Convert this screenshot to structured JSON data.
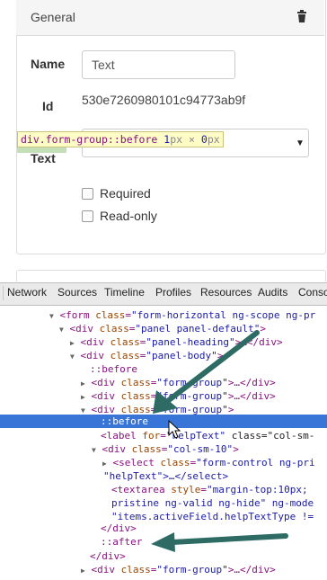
{
  "panel": {
    "title": "General",
    "delete_icon": "trash-icon",
    "fields": {
      "name_label": "Name",
      "name_value": "Text",
      "id_label": "Id",
      "id_value": "530e7260980101c94773ab9f",
      "helptext_label": "Text",
      "required_label": "Required",
      "readonly_label": "Read-only"
    }
  },
  "tooltip": {
    "selector": "div.form-group::before",
    "size_w": "1",
    "size_unit_1": "px",
    "size_x": "×",
    "size_h": "0",
    "size_unit_2": "px"
  },
  "devtools": {
    "tabs": [
      "Network",
      "Sources",
      "Timeline",
      "Profiles",
      "Resources",
      "Audits",
      "Conso"
    ],
    "lines": [
      {
        "tag_open": "<form ",
        "attr": "class",
        "eq": "=",
        "val": "\"form-horizontal ng-scope ng-pr",
        "rest": ""
      },
      {
        "tag_open": "<div ",
        "attr": "class",
        "eq": "=",
        "val": "\"panel panel-default\"",
        "rest": ">"
      },
      {
        "tag_open": "<div ",
        "attr": "class",
        "eq": "=",
        "val": "\"panel-heading\"",
        "rest": ">…</div>"
      },
      {
        "tag_open": "<div ",
        "attr": "class",
        "eq": "=",
        "val": "\"panel-body\"",
        "rest": ">"
      },
      {
        "pseudo": "::before"
      },
      {
        "tag_open": "<div ",
        "attr": "class",
        "eq": "=",
        "val": "\"form-group\"",
        "rest": ">…</div>"
      },
      {
        "tag_open": "<div ",
        "attr": "class",
        "eq": "=",
        "val": "\"form-group\"",
        "rest": ">…</div>"
      },
      {
        "tag_open": "<div ",
        "attr": "class",
        "eq": "=",
        "val": "\"form-group\"",
        "rest": ">"
      },
      {
        "pseudo": "::before"
      },
      {
        "tag_open": "<label ",
        "attr": "for",
        "eq": "=",
        "val": "\"helpText\"",
        "rest": " class=\"col-sm-"
      },
      {
        "tag_open": "<div ",
        "attr": "class",
        "eq": "=",
        "val": "\"col-sm-10\"",
        "rest": ">"
      },
      {
        "tag_open": "<select ",
        "attr": "class",
        "eq": "=",
        "val": "\"form-control ng-pri",
        "rest": ""
      },
      {
        "plain": "\"helpText\">…</select>"
      },
      {
        "tag_open": "<textarea ",
        "attr": "style",
        "eq": "=",
        "val": "\"margin-top:10px;",
        "rest": ""
      },
      {
        "plain": "pristine ng-valid ng-hide\" ng-mode"
      },
      {
        "plain": "\"items.activeField.helpTextType !="
      },
      {
        "plain": "</div>"
      },
      {
        "pseudo": "::after"
      },
      {
        "plain": "</div>"
      },
      {
        "tag_open": "<div ",
        "attr": "class",
        "eq": "=",
        "val": "\"form-group\"",
        "rest": ">…</div>"
      }
    ]
  },
  "colors": {
    "selection": "#3875d7",
    "arrow": "#2e6b64",
    "tooltip_bg": "#fdfbc6"
  }
}
